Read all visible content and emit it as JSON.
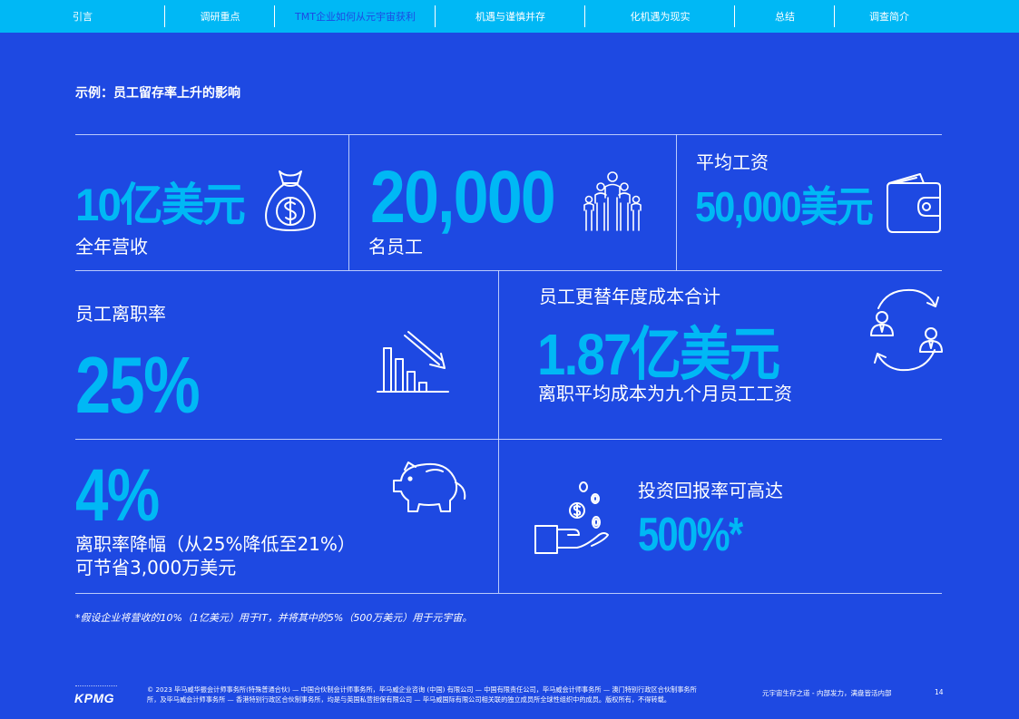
{
  "nav": {
    "items": [
      "引言",
      "调研重点",
      "TMT企业如何从元宇宙获利",
      "机遇与谨慎并存",
      "化机遇为现实",
      "总结",
      "调查简介"
    ]
  },
  "page_title": "示例：员工留存率上升的影响",
  "stats": {
    "revenue": {
      "value": "10亿美元",
      "label": "全年营收"
    },
    "employees": {
      "value": "20,000",
      "label": "名员工"
    },
    "salary": {
      "label": "平均工资",
      "value": "50,000美元"
    },
    "turnover": {
      "label": "员工离职率",
      "value": "25%"
    },
    "replacement": {
      "label": "员工更替年度成本合计",
      "value": "1.87亿美元",
      "note": "离职平均成本为九个月员工工资"
    },
    "savings": {
      "value": "4%",
      "line1": "离职率降幅（从25%降低至21%）",
      "line2": "可节省3,000万美元"
    },
    "roi": {
      "label": "投资回报率可高达",
      "value": "500%*"
    }
  },
  "icons": {
    "revenue": "money-bag-icon",
    "employees": "group-of-people-icon",
    "salary": "wallet-icon",
    "turnover": "declining-bar-chart-icon",
    "replacement": "employee-exchange-icon",
    "savings": "piggy-bank-icon",
    "roi": "hand-with-coins-icon"
  },
  "footnote": "*假设企业将营收的10%（1亿美元）用于IT，并将其中的5%（500万美元）用于元宇宙。",
  "footer": {
    "logo": "KPMG",
    "legal_line1": "© 2023 毕马威华振会计师事务所(特殊普通合伙) — 中国合伙制会计师事务所，毕马威企业咨询 (中国) 有限公司 — 中国有限责任公司，毕马威会计师事务所 — 澳门特别行政区合伙制事务所",
    "legal_line2": "所，及毕马威会计师事务所 — 香港特别行政区合伙制事务所，均是与英国私营担保有限公司 — 毕马威国际有限公司相关联的独立成员所全球性组织中的成员。版权所有，不得转载。",
    "report_title": "元宇宙生存之道 - 内部发力，满盘皆活内部",
    "page_number": "14"
  },
  "colors": {
    "background": "#1E49E2",
    "nav": "#00B8F5",
    "accent": "#00B8F5",
    "text": "#FFFFFF"
  }
}
